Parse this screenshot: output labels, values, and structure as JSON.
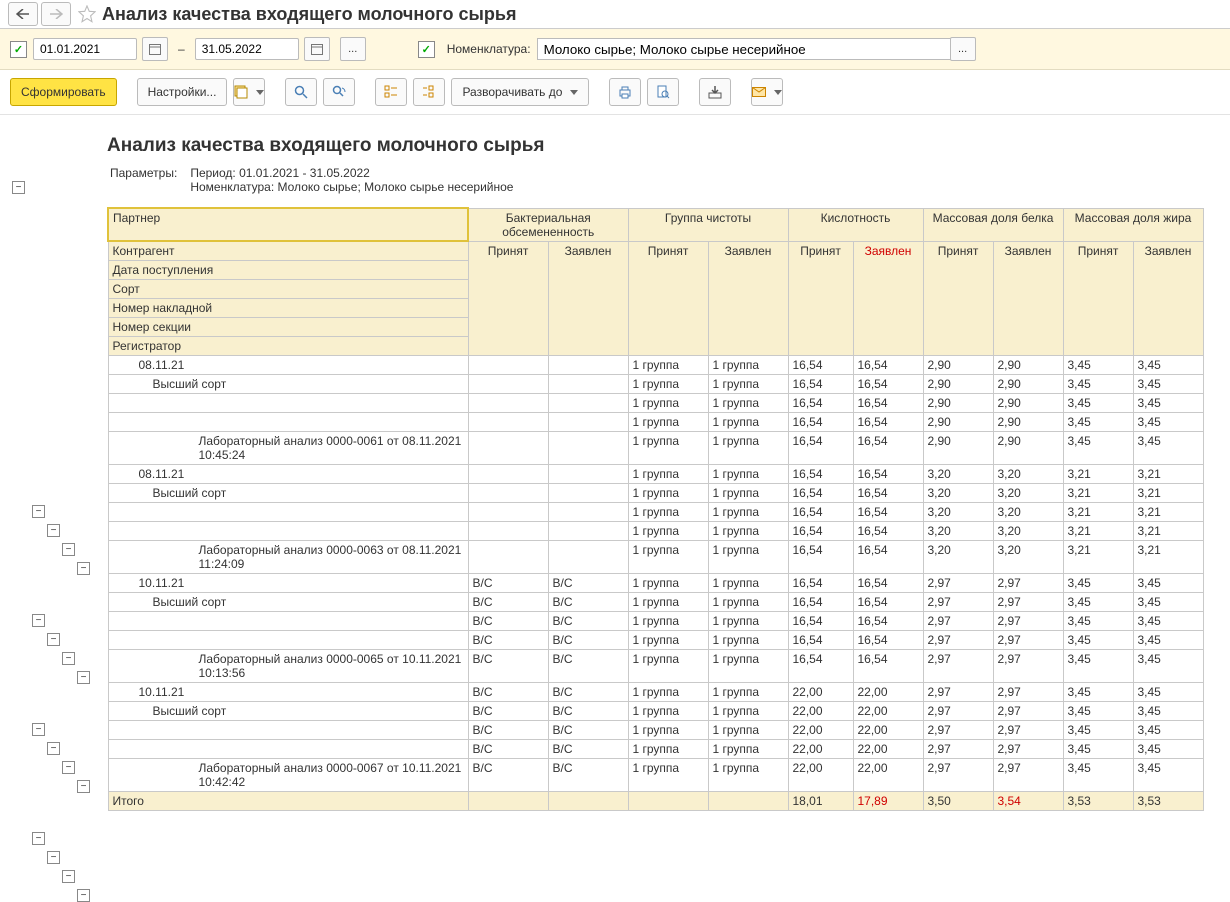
{
  "title": "Анализ качества входящего молочного сырья",
  "filter": {
    "date_from": "01.01.2021",
    "date_to": "31.05.2022",
    "dash": "–",
    "nomenclature_label": "Номенклатура:",
    "nomenclature_value": "Молоко сырье; Молоко сырье несерийное",
    "ellipsis": "..."
  },
  "toolbar": {
    "generate": "Сформировать",
    "settings": "Настройки...",
    "expand_to": "Разворачивать до"
  },
  "report": {
    "heading": "Анализ качества входящего молочного сырья",
    "param_label": "Параметры:",
    "param_period": "Период: 01.01.2021 - 31.05.2022",
    "param_nomenclature": "Номенклатура: Молоко сырье; Молоко сырье несерийное"
  },
  "headers": {
    "partner": "Партнер",
    "kontragent": "Контрагент",
    "date": "Дата поступления",
    "sort": "Сорт",
    "invoice": "Номер накладной",
    "section": "Номер секции",
    "registrator": "Регистратор",
    "groups": [
      "Бактериальная обсемененность",
      "Группа чистоты",
      "Кислотность",
      "Массовая доля белка",
      "Массовая доля жира"
    ],
    "sub_accepted": "Принят",
    "sub_declared": "Заявлен"
  },
  "rows": [
    {
      "lvl": 1,
      "label": "08.11.21",
      "vals": [
        "",
        "",
        "1 группа",
        "1 группа",
        "16,54",
        "16,54",
        "2,90",
        "2,90",
        "3,45",
        "3,45"
      ]
    },
    {
      "lvl": 2,
      "label": "Высший сорт",
      "vals": [
        "",
        "",
        "1 группа",
        "1 группа",
        "16,54",
        "16,54",
        "2,90",
        "2,90",
        "3,45",
        "3,45"
      ]
    },
    {
      "lvl": 3,
      "label": "",
      "vals": [
        "",
        "",
        "1 группа",
        "1 группа",
        "16,54",
        "16,54",
        "2,90",
        "2,90",
        "3,45",
        "3,45"
      ]
    },
    {
      "lvl": 4,
      "label": "",
      "vals": [
        "",
        "",
        "1 группа",
        "1 группа",
        "16,54",
        "16,54",
        "2,90",
        "2,90",
        "3,45",
        "3,45"
      ]
    },
    {
      "lvl": 5,
      "label": "Лабораторный анализ 0000-0061 от 08.11.2021 10:45:24",
      "vals": [
        "",
        "",
        "1 группа",
        "1 группа",
        "16,54",
        "16,54",
        "2,90",
        "2,90",
        "3,45",
        "3,45"
      ]
    },
    {
      "lvl": 1,
      "label": "08.11.21",
      "vals": [
        "",
        "",
        "1 группа",
        "1 группа",
        "16,54",
        "16,54",
        "3,20",
        "3,20",
        "3,21",
        "3,21"
      ]
    },
    {
      "lvl": 2,
      "label": "Высший сорт",
      "vals": [
        "",
        "",
        "1 группа",
        "1 группа",
        "16,54",
        "16,54",
        "3,20",
        "3,20",
        "3,21",
        "3,21"
      ]
    },
    {
      "lvl": 3,
      "label": "",
      "vals": [
        "",
        "",
        "1 группа",
        "1 группа",
        "16,54",
        "16,54",
        "3,20",
        "3,20",
        "3,21",
        "3,21"
      ]
    },
    {
      "lvl": 4,
      "label": "",
      "vals": [
        "",
        "",
        "1 группа",
        "1 группа",
        "16,54",
        "16,54",
        "3,20",
        "3,20",
        "3,21",
        "3,21"
      ]
    },
    {
      "lvl": 5,
      "label": "Лабораторный анализ 0000-0063 от 08.11.2021 11:24:09",
      "vals": [
        "",
        "",
        "1 группа",
        "1 группа",
        "16,54",
        "16,54",
        "3,20",
        "3,20",
        "3,21",
        "3,21"
      ]
    },
    {
      "lvl": 1,
      "label": "10.11.21",
      "vals": [
        "В/С",
        "В/С",
        "1 группа",
        "1 группа",
        "16,54",
        "16,54",
        "2,97",
        "2,97",
        "3,45",
        "3,45"
      ]
    },
    {
      "lvl": 2,
      "label": "Высший сорт",
      "vals": [
        "В/С",
        "В/С",
        "1 группа",
        "1 группа",
        "16,54",
        "16,54",
        "2,97",
        "2,97",
        "3,45",
        "3,45"
      ]
    },
    {
      "lvl": 3,
      "label": "",
      "vals": [
        "В/С",
        "В/С",
        "1 группа",
        "1 группа",
        "16,54",
        "16,54",
        "2,97",
        "2,97",
        "3,45",
        "3,45"
      ]
    },
    {
      "lvl": 4,
      "label": "",
      "vals": [
        "В/С",
        "В/С",
        "1 группа",
        "1 группа",
        "16,54",
        "16,54",
        "2,97",
        "2,97",
        "3,45",
        "3,45"
      ]
    },
    {
      "lvl": 5,
      "label": "Лабораторный анализ 0000-0065 от 10.11.2021 10:13:56",
      "vals": [
        "В/С",
        "В/С",
        "1 группа",
        "1 группа",
        "16,54",
        "16,54",
        "2,97",
        "2,97",
        "3,45",
        "3,45"
      ]
    },
    {
      "lvl": 1,
      "label": "10.11.21",
      "vals": [
        "В/С",
        "В/С",
        "1 группа",
        "1 группа",
        "22,00",
        "22,00",
        "2,97",
        "2,97",
        "3,45",
        "3,45"
      ]
    },
    {
      "lvl": 2,
      "label": "Высший сорт",
      "vals": [
        "В/С",
        "В/С",
        "1 группа",
        "1 группа",
        "22,00",
        "22,00",
        "2,97",
        "2,97",
        "3,45",
        "3,45"
      ]
    },
    {
      "lvl": 3,
      "label": "",
      "vals": [
        "В/С",
        "В/С",
        "1 группа",
        "1 группа",
        "22,00",
        "22,00",
        "2,97",
        "2,97",
        "3,45",
        "3,45"
      ]
    },
    {
      "lvl": 4,
      "label": "",
      "vals": [
        "В/С",
        "В/С",
        "1 группа",
        "1 группа",
        "22,00",
        "22,00",
        "2,97",
        "2,97",
        "3,45",
        "3,45"
      ]
    },
    {
      "lvl": 5,
      "label": "Лабораторный анализ 0000-0067 от 10.11.2021 10:42:42",
      "vals": [
        "В/С",
        "В/С",
        "1 группа",
        "1 группа",
        "22,00",
        "22,00",
        "2,97",
        "2,97",
        "3,45",
        "3,45"
      ]
    }
  ],
  "total": {
    "label": "Итого",
    "vals": [
      "",
      "",
      "",
      "",
      "18,01",
      "17,89",
      "3,50",
      "3,54",
      "3,53",
      "3,53"
    ],
    "red_idx": [
      5,
      7
    ]
  }
}
